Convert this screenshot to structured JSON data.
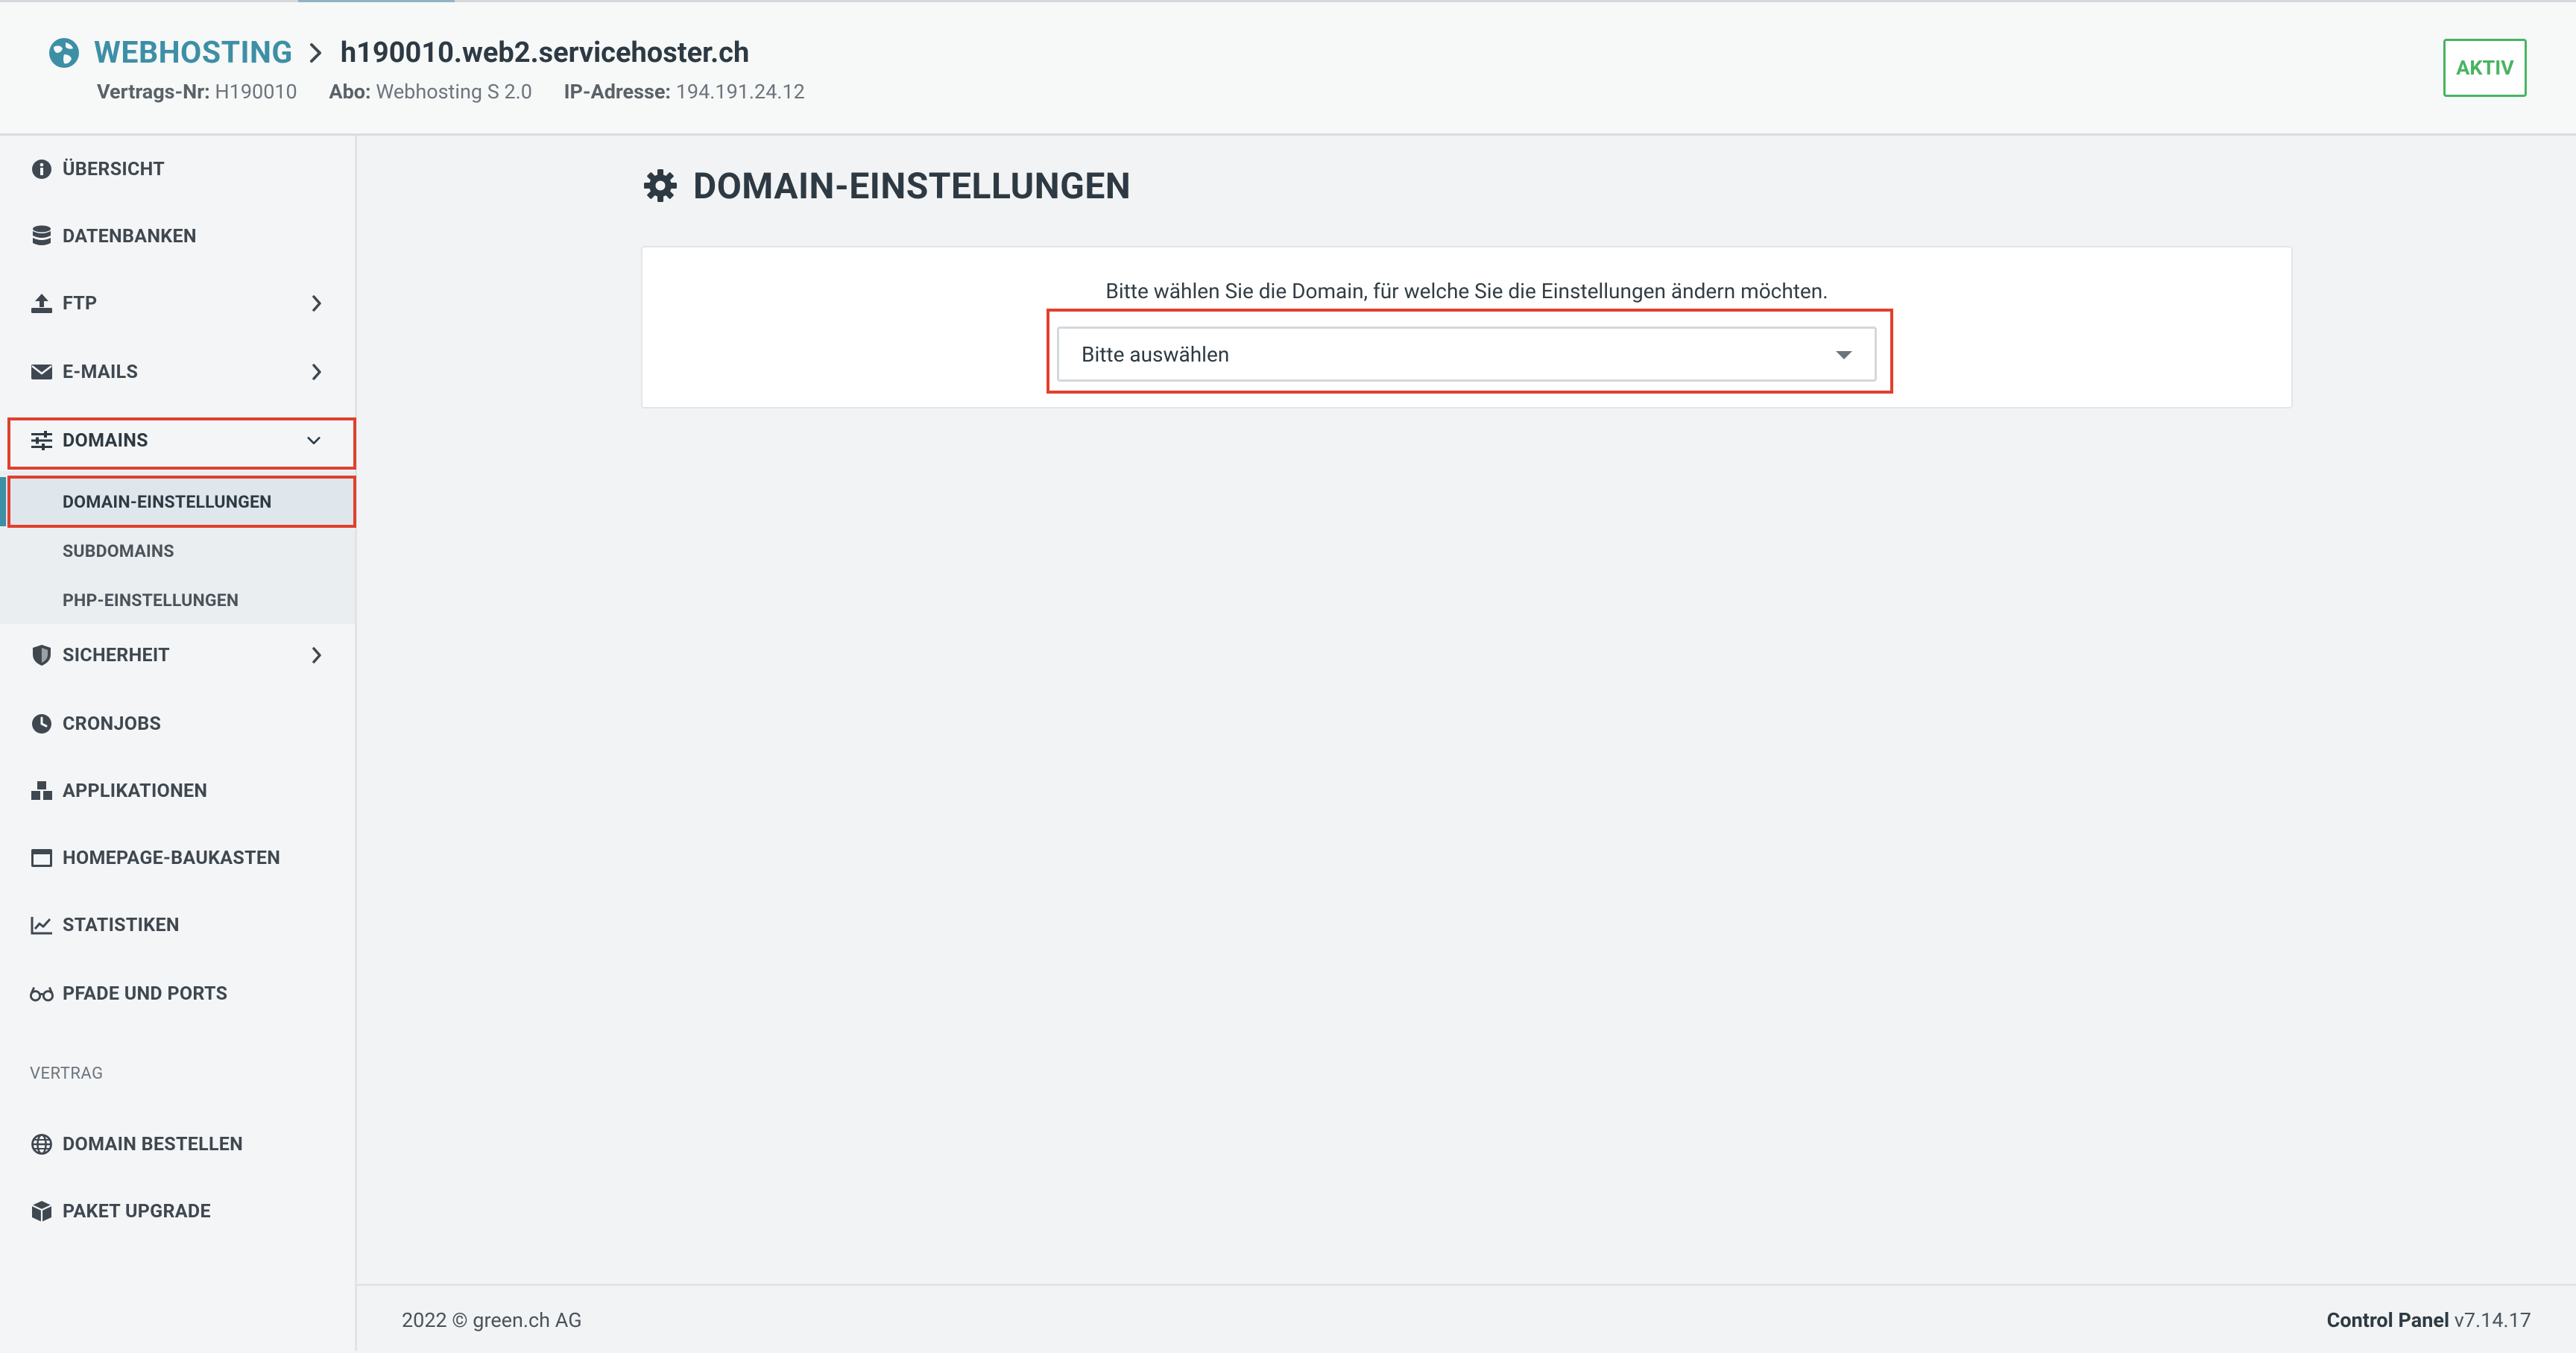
{
  "header": {
    "brand": "WEBHOSTING",
    "hostname": "h190010.web2.servicehoster.ch",
    "meta": [
      {
        "key": "Vertrags-Nr:",
        "value": "H190010"
      },
      {
        "key": "Abo:",
        "value": "Webhosting S 2.0"
      },
      {
        "key": "IP-Adresse:",
        "value": "194.191.24.12"
      }
    ],
    "status": "AKTIV"
  },
  "sidebar": {
    "items": [
      {
        "label": "ÜBERSICHT",
        "icon": "info-circle-icon"
      },
      {
        "label": "DATENBANKEN",
        "icon": "database-icon"
      },
      {
        "label": "FTP",
        "icon": "upload-icon"
      },
      {
        "label": "E-MAILS",
        "icon": "envelope-icon"
      },
      {
        "label": "DOMAINS",
        "icon": "sliders-icon"
      },
      {
        "label": "SICHERHEIT",
        "icon": "shield-icon"
      },
      {
        "label": "CRONJOBS",
        "icon": "clock-icon"
      },
      {
        "label": "APPLIKATIONEN",
        "icon": "cubes-icon"
      },
      {
        "label": "HOMEPAGE-BAUKASTEN",
        "icon": "window-icon"
      },
      {
        "label": "STATISTIKEN",
        "icon": "line-chart-icon"
      },
      {
        "label": "PFADE UND PORTS",
        "icon": "glasses-icon"
      }
    ],
    "domains_sub": [
      {
        "label": "DOMAIN-EINSTELLUNGEN"
      },
      {
        "label": "SUBDOMAINS"
      },
      {
        "label": "PHP-EINSTELLUNGEN"
      }
    ],
    "section_vertrag": "VERTRAG",
    "vertrag_items": [
      {
        "label": "DOMAIN BESTELLEN",
        "icon": "globe-icon"
      },
      {
        "label": "PAKET UPGRADE",
        "icon": "box-icon"
      }
    ]
  },
  "main": {
    "title": "DOMAIN-EINSTELLUNGEN",
    "hint": "Bitte wählen Sie die Domain, für welche Sie die Einstellungen ändern möchten.",
    "select_value": "Bitte auswählen"
  },
  "footer": {
    "copyright": "2022 © green.ch AG",
    "product": "Control Panel",
    "version": "v7.14.17"
  },
  "colors": {
    "brand": "#3d8fa6",
    "status_green": "#48b461",
    "highlight_red": "#e0402e"
  }
}
